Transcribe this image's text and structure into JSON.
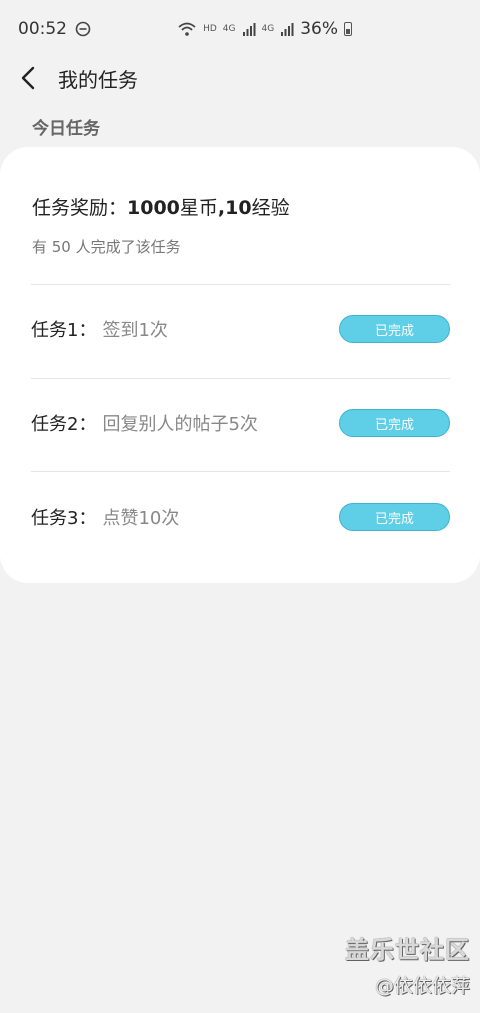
{
  "status_bar": {
    "time": "00:52",
    "hd": "HD",
    "net1": "4G",
    "net2": "4G",
    "battery": "36%"
  },
  "header": {
    "title": "我的任务"
  },
  "section": {
    "title": "今日任务"
  },
  "reward": {
    "label": "任务奖励：",
    "coins": "1000",
    "coins_unit": "星币",
    "sep": ",",
    "exp": "10",
    "exp_unit": "经验"
  },
  "completed_count": "有 50 人完成了该任务",
  "tasks": [
    {
      "label": "任务1：",
      "desc": "签到1次",
      "status": "已完成"
    },
    {
      "label": "任务2：",
      "desc": "回复别人的帖子5次",
      "status": "已完成"
    },
    {
      "label": "任务3：",
      "desc": "点赞10次",
      "status": "已完成"
    }
  ],
  "watermark": {
    "site": "盖乐世社区",
    "user": "@依依依萍"
  },
  "colors": {
    "accent": "#5fcfe8",
    "background": "#f2f2f2",
    "card": "#ffffff"
  }
}
